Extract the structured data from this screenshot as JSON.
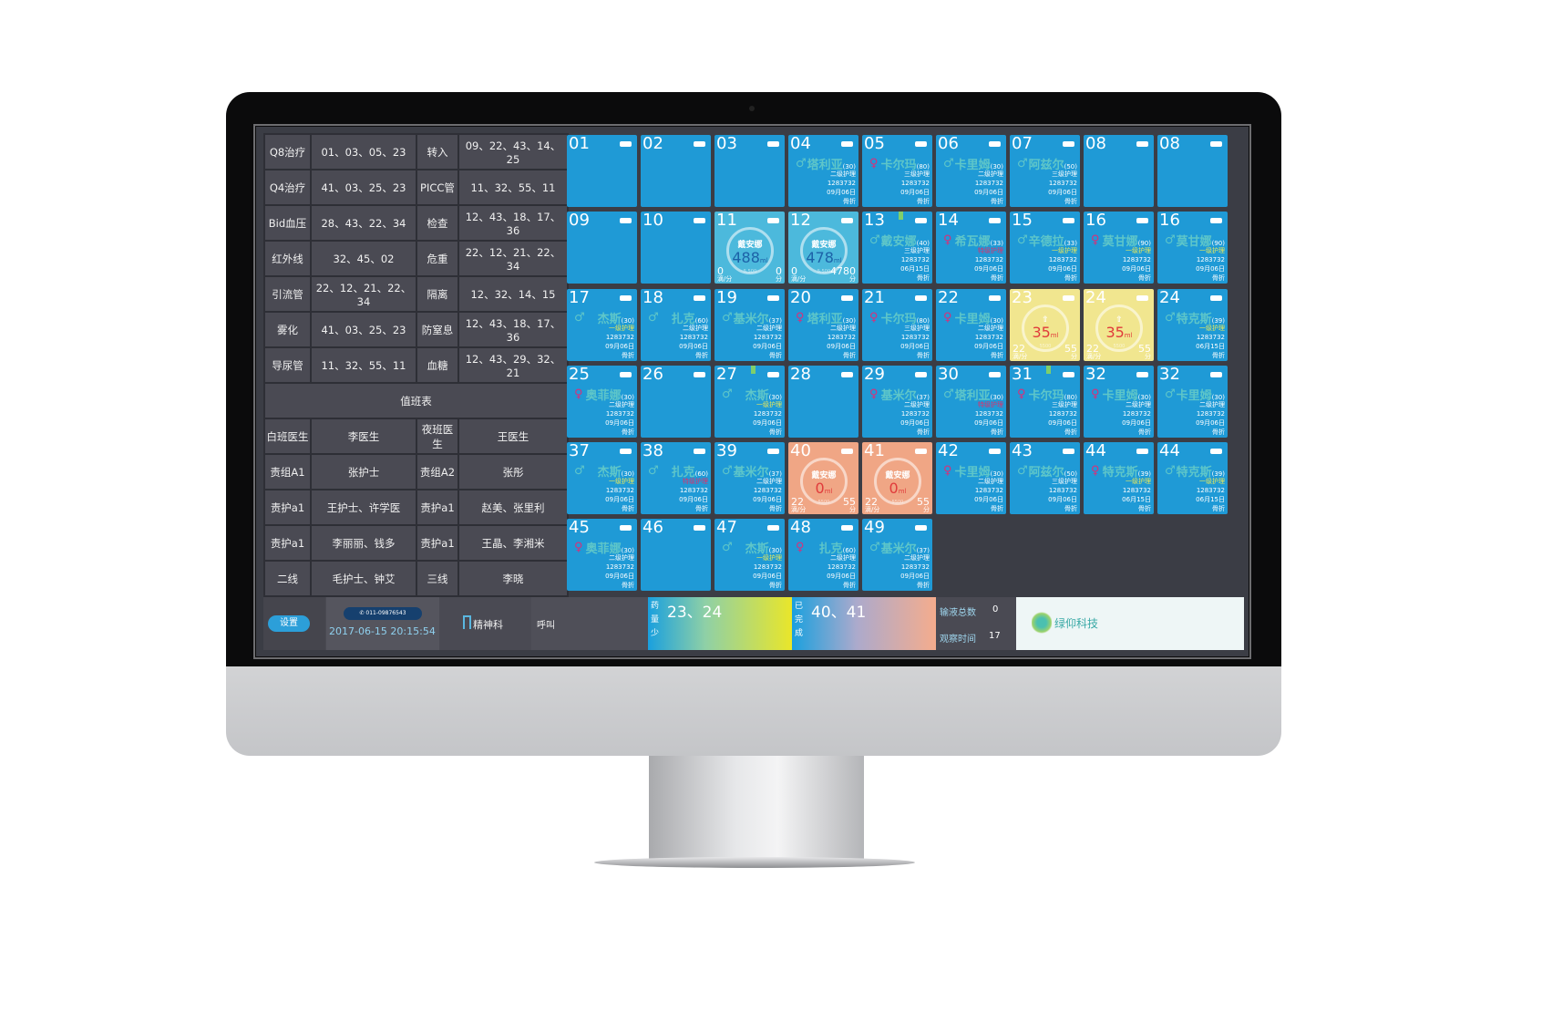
{
  "colors": {
    "tile": "#1f9ad6",
    "label": "#2ea7dc",
    "name": "#5ec6c9",
    "level1": "#e8e85a",
    "special": "#e0306a"
  },
  "tasks": [
    [
      "Q8治疗",
      "01、03、05、23",
      "转入",
      "09、22、43、14、25"
    ],
    [
      "Q4治疗",
      "41、03、25、23",
      "PICC管",
      "11、32、55、11"
    ],
    [
      "Bid血压",
      "28、43、22、34",
      "检查",
      "12、43、18、17、36"
    ],
    [
      "红外线",
      "32、45、02",
      "危重",
      "22、12、21、22、34"
    ],
    [
      "引流管",
      "22、12、21、22、34",
      "隔离",
      "12、32、14、15"
    ],
    [
      "雾化",
      "41、03、25、23",
      "防窒息",
      "12、43、18、17、36"
    ],
    [
      "导尿管",
      "11、32、55、11",
      "血糖",
      "12、43、29、32、21"
    ]
  ],
  "duty_title": "值班表",
  "duty": [
    [
      "白班医生",
      "李医生",
      "夜班医生",
      "王医生"
    ],
    [
      "责组A1",
      "张护士",
      "责组A2",
      "张彤"
    ],
    [
      "责护a1",
      "王护士、许学医",
      "责护a1",
      "赵美、张里利"
    ],
    [
      "责护a1",
      "李丽丽、钱多",
      "责护a1",
      "王晶、李湘米"
    ],
    [
      "二线",
      "毛护士、钟艾",
      "三线",
      "李晓"
    ]
  ],
  "footer": {
    "settings": "设置",
    "phone": "011-09876543",
    "datetime": "2017-06-15 20:15:54",
    "department": "精神科",
    "call": "呼叫",
    "low_label": "药量少",
    "low_beds": "23、24",
    "done_label": "已完成",
    "done_beds": "40、41",
    "total_label": "输液总数",
    "total_value": "0",
    "obs_label": "观察时间",
    "obs_value": "17",
    "logo": "绿仰科技"
  },
  "beds": [
    {
      "n": "01"
    },
    {
      "n": "02"
    },
    {
      "n": "03"
    },
    {
      "n": "04",
      "sex": "♂",
      "name": "塔利亚",
      "age": "(30)",
      "level": "二级护理",
      "id": "1283732",
      "date": "09月06日",
      "dx": "骨折"
    },
    {
      "n": "05",
      "sex": "♀",
      "name": "卡尔玛",
      "age": "(80)",
      "level": "三级护理",
      "id": "1283732",
      "date": "09月06日",
      "dx": "骨折"
    },
    {
      "n": "06",
      "sex": "♂",
      "name": "卡里姆",
      "age": "(30)",
      "level": "二级护理",
      "id": "1283732",
      "date": "09月06日",
      "dx": "骨折"
    },
    {
      "n": "07",
      "sex": "♂",
      "name": "阿兹尔",
      "age": "(50)",
      "level": "三级护理",
      "id": "1283732",
      "date": "09月06日",
      "dx": "骨折"
    },
    {
      "n": "08"
    },
    {
      "n": "08"
    },
    {
      "n": "09"
    },
    {
      "n": "10"
    },
    {
      "n": "11",
      "type": "infusion",
      "name": "戴安娜",
      "vol": "488",
      "unit": "ml",
      "total": "5,500",
      "rate": "0",
      "rate_unit": "滴/分",
      "time": "0",
      "time_unit": "分"
    },
    {
      "n": "12",
      "type": "infusion",
      "name": "戴安娜",
      "vol": "478",
      "unit": "ml",
      "total": "5,500",
      "rate": "0",
      "rate_unit": "滴/分",
      "time": "4780",
      "time_unit": "分"
    },
    {
      "n": "13",
      "sex": "♂",
      "name": "戴安娜",
      "age": "(40)",
      "level": "三级护理",
      "id": "1283732",
      "date": "06月15日",
      "dx": "骨折",
      "bookmark": true
    },
    {
      "n": "14",
      "sex": "♀",
      "name": "希瓦娜",
      "age": "(33)",
      "level": "特级护理",
      "id": "1283732",
      "date": "09月06日",
      "dx": "骨折"
    },
    {
      "n": "15",
      "sex": "♂",
      "name": "辛德拉",
      "age": "(33)",
      "level": "一级护理",
      "id": "1283732",
      "date": "09月06日",
      "dx": "骨折"
    },
    {
      "n": "16",
      "sex": "♀",
      "name": "莫甘娜",
      "age": "(90)",
      "level": "一级护理",
      "id": "1283732",
      "date": "09月06日",
      "dx": "骨折"
    },
    {
      "n": "16",
      "sex": "♂",
      "name": "莫甘娜",
      "age": "(90)",
      "level": "一级护理",
      "id": "1283732",
      "date": "09月06日",
      "dx": "骨折"
    },
    {
      "n": "17",
      "sex": "♂",
      "name": "杰斯",
      "age": "(30)",
      "level": "一级护理",
      "id": "1283732",
      "date": "09月06日",
      "dx": "骨折"
    },
    {
      "n": "18",
      "sex": "♂",
      "name": "扎克",
      "age": "(60)",
      "level": "二级护理",
      "id": "1283732",
      "date": "09月06日",
      "dx": "骨折"
    },
    {
      "n": "19",
      "sex": "♂",
      "name": "基米尔",
      "age": "(37)",
      "level": "二级护理",
      "id": "1283732",
      "date": "09月06日",
      "dx": "骨折"
    },
    {
      "n": "20",
      "sex": "♀",
      "name": "塔利亚",
      "age": "(30)",
      "level": "二级护理",
      "id": "1283732",
      "date": "09月06日",
      "dx": "骨折"
    },
    {
      "n": "21",
      "sex": "♀",
      "name": "卡尔玛",
      "age": "(80)",
      "level": "三级护理",
      "id": "1283732",
      "date": "09月06日",
      "dx": "骨折"
    },
    {
      "n": "22",
      "sex": "♀",
      "name": "卡里姆",
      "age": "(30)",
      "level": "二级护理",
      "id": "1283732",
      "date": "09月06日",
      "dx": "骨折"
    },
    {
      "n": "23",
      "type": "low",
      "vol": "35",
      "unit": "ml",
      "total": "5500",
      "rate": "22",
      "rate_unit": "滴/分",
      "time": "55",
      "time_unit": "分"
    },
    {
      "n": "24",
      "type": "low",
      "vol": "35",
      "unit": "ml",
      "total": "5500",
      "rate": "22",
      "rate_unit": "滴/分",
      "time": "55",
      "time_unit": "分"
    },
    {
      "n": "24",
      "sex": "♂",
      "name": "特克斯",
      "age": "(39)",
      "level": "一级护理",
      "id": "1283732",
      "date": "06月15日",
      "dx": "骨折"
    },
    {
      "n": "25",
      "sex": "♀",
      "name": "奥菲娜",
      "age": "(30)",
      "level": "二级护理",
      "id": "1283732",
      "date": "09月06日",
      "dx": "骨折"
    },
    {
      "n": "26"
    },
    {
      "n": "27",
      "sex": "♂",
      "name": "杰斯",
      "age": "(30)",
      "level": "一级护理",
      "id": "1283732",
      "date": "09月06日",
      "dx": "骨折",
      "bookmark": true
    },
    {
      "n": "28"
    },
    {
      "n": "29",
      "sex": "♀",
      "name": "基米尔",
      "age": "(37)",
      "level": "二级护理",
      "id": "1283732",
      "date": "09月06日",
      "dx": "骨折"
    },
    {
      "n": "30",
      "sex": "♂",
      "name": "塔利亚",
      "age": "(30)",
      "level": "特级护理",
      "id": "1283732",
      "date": "09月06日",
      "dx": "骨折"
    },
    {
      "n": "31",
      "sex": "♀",
      "name": "卡尔玛",
      "age": "(80)",
      "level": "三级护理",
      "id": "1283732",
      "date": "09月06日",
      "dx": "骨折",
      "bookmark": true
    },
    {
      "n": "32",
      "sex": "♀",
      "name": "卡里姆",
      "age": "(30)",
      "level": "二级护理",
      "id": "1283732",
      "date": "09月06日",
      "dx": "骨折"
    },
    {
      "n": "32",
      "sex": "♂",
      "name": "卡里姆",
      "age": "(30)",
      "level": "二级护理",
      "id": "1283732",
      "date": "09月06日",
      "dx": "骨折"
    },
    {
      "n": "37",
      "sex": "♂",
      "name": "杰斯",
      "age": "(30)",
      "level": "一级护理",
      "id": "1283732",
      "date": "09月06日",
      "dx": "骨折"
    },
    {
      "n": "38",
      "sex": "♂",
      "name": "扎克",
      "age": "(60)",
      "level": "特级护理",
      "id": "1283732",
      "date": "09月06日",
      "dx": "骨折"
    },
    {
      "n": "39",
      "sex": "♂",
      "name": "基米尔",
      "age": "(37)",
      "level": "二级护理",
      "id": "1283732",
      "date": "09月06日",
      "dx": "骨折"
    },
    {
      "n": "40",
      "type": "done",
      "name": "戴安娜",
      "vol": "0",
      "unit": "ml",
      "total": "5500",
      "rate": "22",
      "rate_unit": "滴/分",
      "time": "55",
      "time_unit": "分"
    },
    {
      "n": "41",
      "type": "done",
      "name": "戴安娜",
      "vol": "0",
      "unit": "ml",
      "total": "5500",
      "rate": "22",
      "rate_unit": "滴/分",
      "time": "55",
      "time_unit": "分"
    },
    {
      "n": "42",
      "sex": "♀",
      "name": "卡里姆",
      "age": "(30)",
      "level": "二级护理",
      "id": "1283732",
      "date": "09月06日",
      "dx": "骨折"
    },
    {
      "n": "43",
      "sex": "♂",
      "name": "阿兹尔",
      "age": "(50)",
      "level": "三级护理",
      "id": "1283732",
      "date": "09月06日",
      "dx": "骨折"
    },
    {
      "n": "44",
      "sex": "♀",
      "name": "特克斯",
      "age": "(39)",
      "level": "一级护理",
      "id": "1283732",
      "date": "06月15日",
      "dx": "骨折"
    },
    {
      "n": "44",
      "sex": "♂",
      "name": "特克斯",
      "age": "(39)",
      "level": "一级护理",
      "id": "1283732",
      "date": "06月15日",
      "dx": "骨折"
    },
    {
      "n": "45",
      "sex": "♀",
      "name": "奥菲娜",
      "age": "(30)",
      "level": "二级护理",
      "id": "1283732",
      "date": "09月06日",
      "dx": "骨折"
    },
    {
      "n": "46"
    },
    {
      "n": "47",
      "sex": "♂",
      "name": "杰斯",
      "age": "(30)",
      "level": "一级护理",
      "id": "1283732",
      "date": "09月06日",
      "dx": "骨折"
    },
    {
      "n": "48",
      "sex": "♀",
      "name": "扎克",
      "age": "(60)",
      "level": "二级护理",
      "id": "1283732",
      "date": "09月06日",
      "dx": "骨折"
    },
    {
      "n": "49",
      "sex": "♂",
      "name": "基米尔",
      "age": "(37)",
      "level": "二级护理",
      "id": "1283732",
      "date": "09月06日",
      "dx": "骨折"
    }
  ]
}
